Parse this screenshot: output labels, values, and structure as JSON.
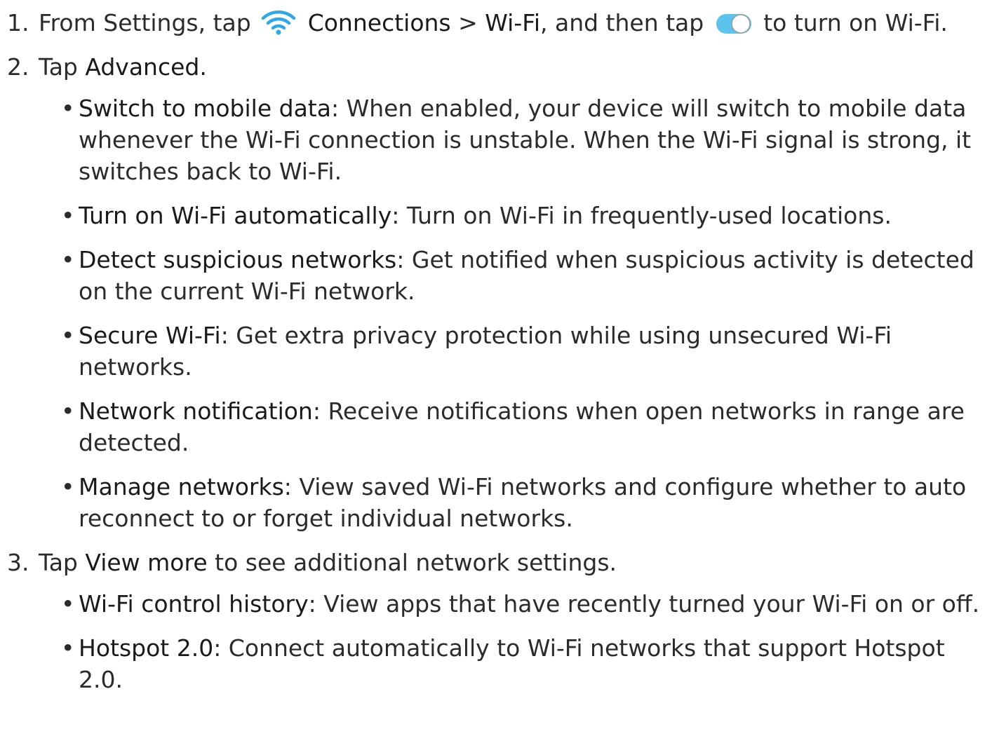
{
  "steps": [
    {
      "num": "1.",
      "p1": "From Settings, tap",
      "connections": "Connections",
      "sep": " > ",
      "wifi": "Wi-Fi",
      "p2": ", and then tap",
      "p3": "to turn on Wi-Fi."
    },
    {
      "num": "2.",
      "p1": "Tap ",
      "action": "Advanced.",
      "items": [
        {
          "bullet": "•",
          "label": "Switch to mobile data",
          "text": ": When enabled, your device will switch to mobile data whenever the Wi-Fi connection is unstable. When the Wi-Fi signal is strong, it switches back to Wi-Fi."
        },
        {
          "bullet": "•",
          "label": "Turn on Wi-Fi automatically",
          "text": ": Turn on Wi-Fi in frequently-used locations."
        },
        {
          "bullet": "•",
          "label": "Detect suspicious networks",
          "text": ": Get notified when suspicious activity is detected on the current Wi-Fi network."
        },
        {
          "bullet": "•",
          "label": "Secure Wi-Fi",
          "text": ": Get extra privacy protection while using unsecured Wi-Fi networks."
        },
        {
          "bullet": "•",
          "label": "Network notification",
          "text": ": Receive notifications when open networks in range are detected."
        },
        {
          "bullet": "•",
          "label": "Manage networks",
          "text": ": View saved Wi-Fi networks and configure whether to auto reconnect to or forget individual networks."
        }
      ]
    },
    {
      "num": "3.",
      "p1": "Tap ",
      "action": "View more",
      "p2": " to see additional network settings.",
      "items": [
        {
          "bullet": "•",
          "label": "Wi-Fi control history",
          "text": ": View apps that have recently turned your Wi-Fi on or off."
        },
        {
          "bullet": "•",
          "label": "Hotspot 2.0",
          "text": ": Connect automatically to Wi-Fi networks that support Hotspot 2.0."
        }
      ]
    }
  ],
  "icons": {
    "wifi": "wifi-icon",
    "toggle": "toggle-on-icon"
  },
  "colors": {
    "accent": "#2ea8e6",
    "toggle_track": "#5cc4ec",
    "text": "#2b2b2b"
  }
}
